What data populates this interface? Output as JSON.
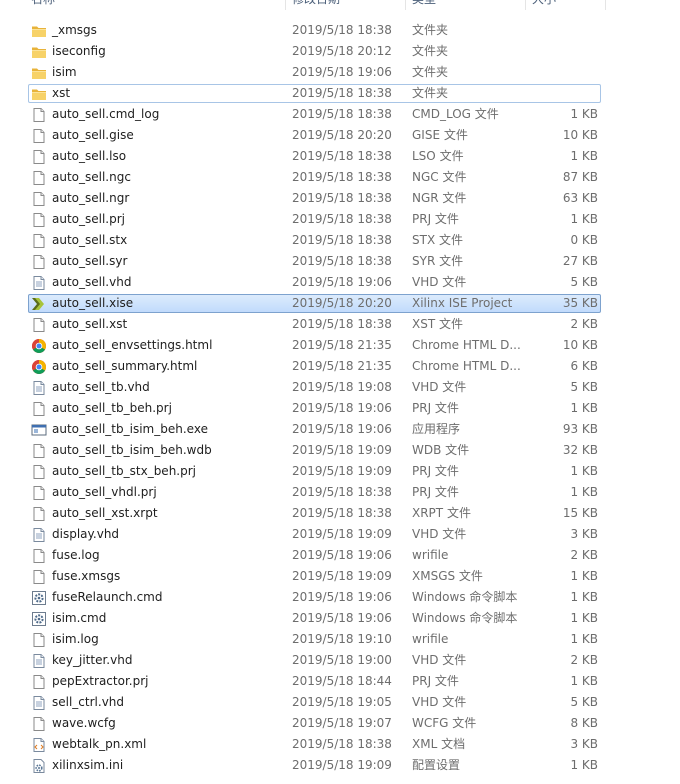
{
  "columns": {
    "name": "名称",
    "date": "修改日期",
    "type": "类型",
    "size": "大小"
  },
  "files": [
    {
      "name": "_xmsgs",
      "date": "2019/5/18 18:38",
      "type": "文件夹",
      "size": "",
      "icon": "folder-icon"
    },
    {
      "name": "iseconfig",
      "date": "2019/5/18 20:12",
      "type": "文件夹",
      "size": "",
      "icon": "folder-icon"
    },
    {
      "name": "isim",
      "date": "2019/5/18 19:06",
      "type": "文件夹",
      "size": "",
      "icon": "folder-icon"
    },
    {
      "name": "xst",
      "date": "2019/5/18 18:38",
      "type": "文件夹",
      "size": "",
      "icon": "folder-icon",
      "state": "focus"
    },
    {
      "name": "auto_sell.cmd_log",
      "date": "2019/5/18 18:38",
      "type": "CMD_LOG 文件",
      "size": "1 KB",
      "icon": "file-icon"
    },
    {
      "name": "auto_sell.gise",
      "date": "2019/5/18 20:20",
      "type": "GISE 文件",
      "size": "10 KB",
      "icon": "file-icon"
    },
    {
      "name": "auto_sell.lso",
      "date": "2019/5/18 18:38",
      "type": "LSO 文件",
      "size": "1 KB",
      "icon": "file-icon"
    },
    {
      "name": "auto_sell.ngc",
      "date": "2019/5/18 18:38",
      "type": "NGC 文件",
      "size": "87 KB",
      "icon": "file-icon"
    },
    {
      "name": "auto_sell.ngr",
      "date": "2019/5/18 18:38",
      "type": "NGR 文件",
      "size": "63 KB",
      "icon": "file-icon"
    },
    {
      "name": "auto_sell.prj",
      "date": "2019/5/18 18:38",
      "type": "PRJ 文件",
      "size": "1 KB",
      "icon": "file-icon"
    },
    {
      "name": "auto_sell.stx",
      "date": "2019/5/18 18:38",
      "type": "STX 文件",
      "size": "0 KB",
      "icon": "file-icon"
    },
    {
      "name": "auto_sell.syr",
      "date": "2019/5/18 18:38",
      "type": "SYR 文件",
      "size": "27 KB",
      "icon": "file-icon"
    },
    {
      "name": "auto_sell.vhd",
      "date": "2019/5/18 19:06",
      "type": "VHD 文件",
      "size": "5 KB",
      "icon": "text-file-icon"
    },
    {
      "name": "auto_sell.xise",
      "date": "2019/5/18 20:20",
      "type": "Xilinx ISE Project",
      "size": "35 KB",
      "icon": "xilinx-ise-icon",
      "state": "selected"
    },
    {
      "name": "auto_sell.xst",
      "date": "2019/5/18 18:38",
      "type": "XST 文件",
      "size": "2 KB",
      "icon": "file-icon"
    },
    {
      "name": "auto_sell_envsettings.html",
      "date": "2019/5/18 21:35",
      "type": "Chrome HTML D...",
      "size": "10 KB",
      "icon": "chrome-icon"
    },
    {
      "name": "auto_sell_summary.html",
      "date": "2019/5/18 21:35",
      "type": "Chrome HTML D...",
      "size": "6 KB",
      "icon": "chrome-icon"
    },
    {
      "name": "auto_sell_tb.vhd",
      "date": "2019/5/18 19:08",
      "type": "VHD 文件",
      "size": "5 KB",
      "icon": "text-file-icon"
    },
    {
      "name": "auto_sell_tb_beh.prj",
      "date": "2019/5/18 19:06",
      "type": "PRJ 文件",
      "size": "1 KB",
      "icon": "file-icon"
    },
    {
      "name": "auto_sell_tb_isim_beh.exe",
      "date": "2019/5/18 19:06",
      "type": "应用程序",
      "size": "93 KB",
      "icon": "exe-icon"
    },
    {
      "name": "auto_sell_tb_isim_beh.wdb",
      "date": "2019/5/18 19:09",
      "type": "WDB 文件",
      "size": "32 KB",
      "icon": "file-icon"
    },
    {
      "name": "auto_sell_tb_stx_beh.prj",
      "date": "2019/5/18 19:09",
      "type": "PRJ 文件",
      "size": "1 KB",
      "icon": "file-icon"
    },
    {
      "name": "auto_sell_vhdl.prj",
      "date": "2019/5/18 18:38",
      "type": "PRJ 文件",
      "size": "1 KB",
      "icon": "file-icon"
    },
    {
      "name": "auto_sell_xst.xrpt",
      "date": "2019/5/18 18:38",
      "type": "XRPT 文件",
      "size": "15 KB",
      "icon": "file-icon"
    },
    {
      "name": "display.vhd",
      "date": "2019/5/18 19:09",
      "type": "VHD 文件",
      "size": "3 KB",
      "icon": "text-file-icon"
    },
    {
      "name": "fuse.log",
      "date": "2019/5/18 19:06",
      "type": "wrifile",
      "size": "2 KB",
      "icon": "file-icon"
    },
    {
      "name": "fuse.xmsgs",
      "date": "2019/5/18 19:09",
      "type": "XMSGS 文件",
      "size": "1 KB",
      "icon": "file-icon"
    },
    {
      "name": "fuseRelaunch.cmd",
      "date": "2019/5/18 19:06",
      "type": "Windows 命令脚本",
      "size": "1 KB",
      "icon": "cmd-gear-icon"
    },
    {
      "name": "isim.cmd",
      "date": "2019/5/18 19:06",
      "type": "Windows 命令脚本",
      "size": "1 KB",
      "icon": "cmd-gear-icon"
    },
    {
      "name": "isim.log",
      "date": "2019/5/18 19:10",
      "type": "wrifile",
      "size": "1 KB",
      "icon": "file-icon"
    },
    {
      "name": "key_jitter.vhd",
      "date": "2019/5/18 19:00",
      "type": "VHD 文件",
      "size": "2 KB",
      "icon": "text-file-icon"
    },
    {
      "name": "pepExtractor.prj",
      "date": "2019/5/18 18:44",
      "type": "PRJ 文件",
      "size": "1 KB",
      "icon": "file-icon"
    },
    {
      "name": "sell_ctrl.vhd",
      "date": "2019/5/18 19:05",
      "type": "VHD 文件",
      "size": "5 KB",
      "icon": "text-file-icon"
    },
    {
      "name": "wave.wcfg",
      "date": "2019/5/18 19:07",
      "type": "WCFG 文件",
      "size": "8 KB",
      "icon": "file-icon"
    },
    {
      "name": "webtalk_pn.xml",
      "date": "2019/5/18 18:38",
      "type": "XML 文档",
      "size": "3 KB",
      "icon": "xml-doc-icon"
    },
    {
      "name": "xilinxsim.ini",
      "date": "2019/5/18 19:09",
      "type": "配置设置",
      "size": "1 KB",
      "icon": "ini-gear-icon"
    }
  ],
  "colors": {
    "selection_border": "#7da2ce",
    "selection_fill": "#cce0f8",
    "focus_border": "#a8c5e6",
    "folder_yellow": "#f2c94c",
    "secondary_text": "#6d6d6d"
  }
}
